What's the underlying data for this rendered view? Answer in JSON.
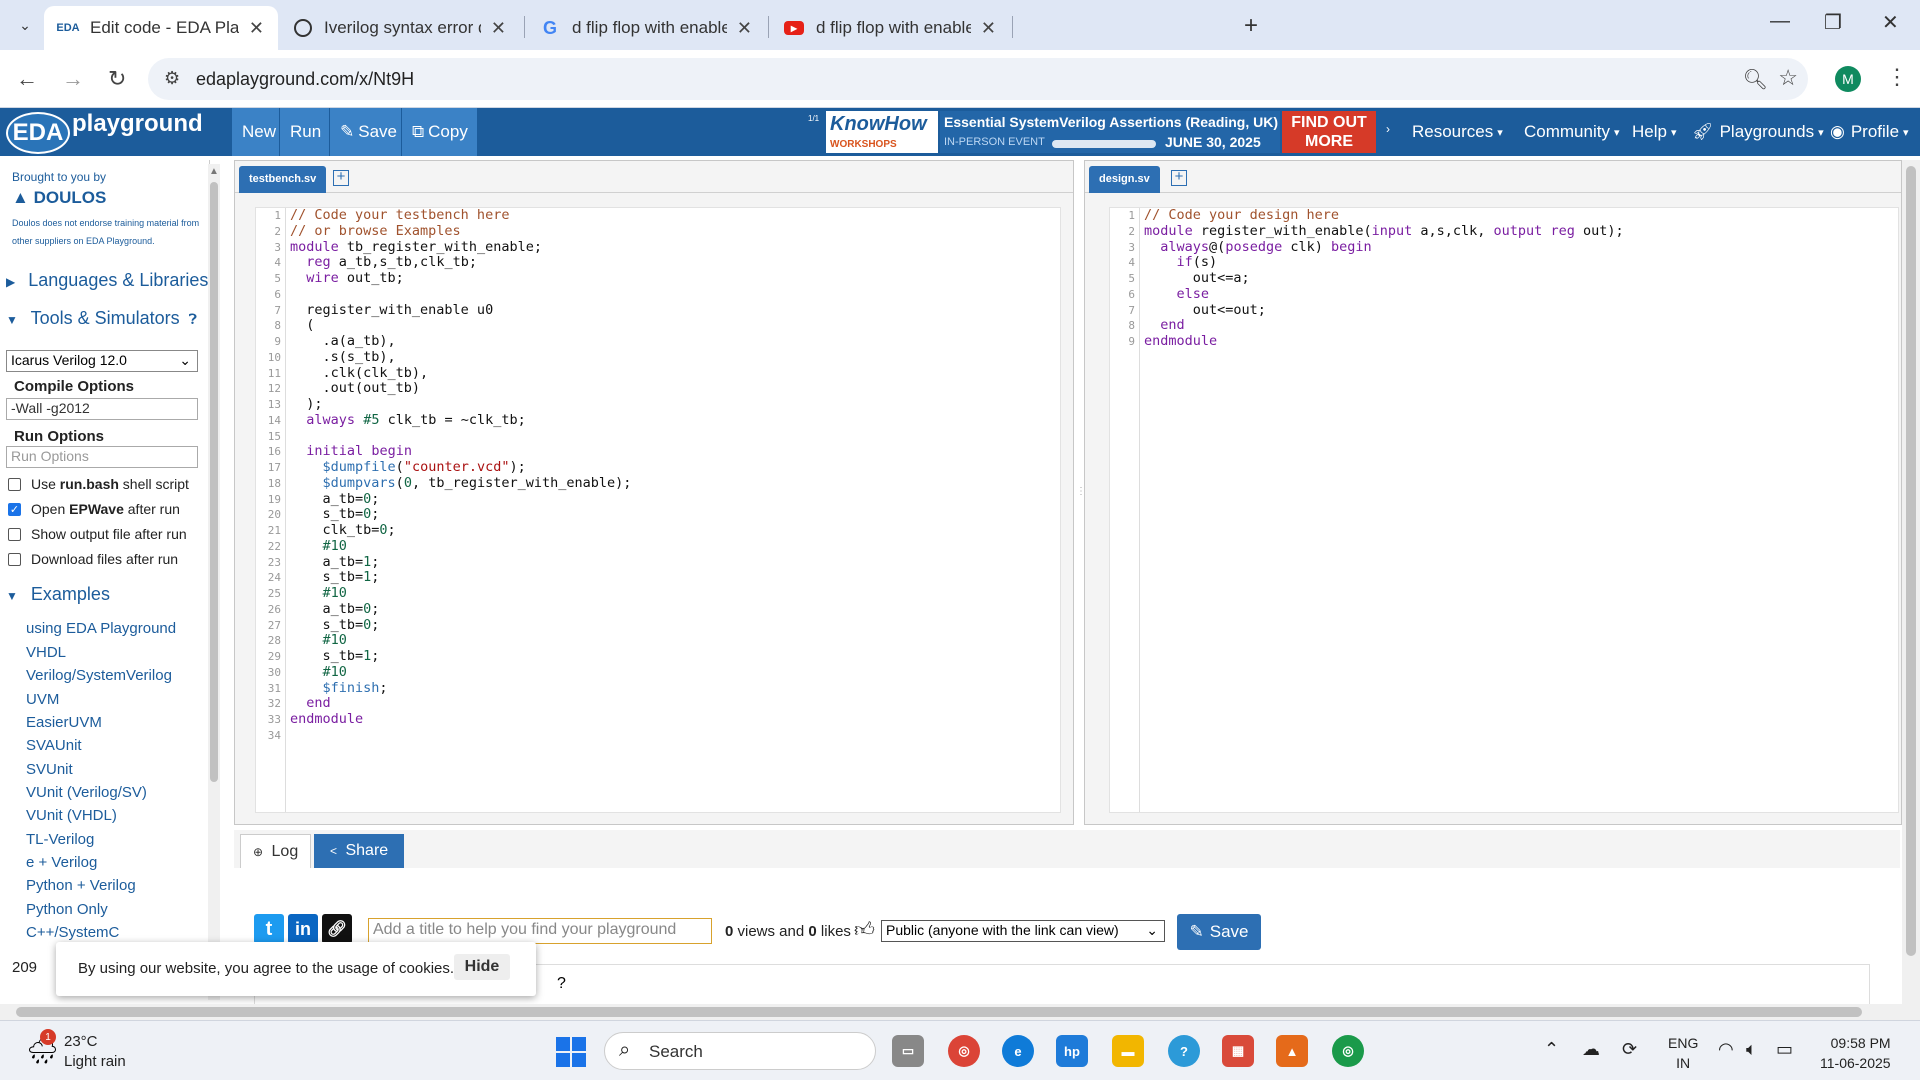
{
  "browser": {
    "tabs": [
      {
        "label": "Edit code - EDA Playground",
        "favicon": "eda-favicon",
        "active": true
      },
      {
        "label": "Iverilog syntax error debug",
        "favicon": "chatgpt-favicon",
        "active": false
      },
      {
        "label": "d flip flop with enable verilog c",
        "favicon": "google-favicon",
        "active": false
      },
      {
        "label": "d flip flop with enable - YouTub",
        "favicon": "youtube-favicon",
        "active": false
      }
    ],
    "url": "edaplayground.com/x/Nt9H",
    "profile_initial": "M"
  },
  "edanav": {
    "logo_eda": "EDA",
    "logo_playground": "playground",
    "buttons": {
      "new": "New",
      "run": "Run",
      "save": "Save",
      "copy": "Copy"
    },
    "ad": {
      "counter": "1/1",
      "know1": "KnowHow",
      "know2": "WORKSHOPS",
      "title": "Essential SystemVerilog Assertions (Reading, UK)",
      "event": "IN-PERSON EVENT",
      "date": "JUNE 30, 2025",
      "cta": "FIND OUT MORE"
    },
    "menu": {
      "resources": "Resources",
      "community": "Community",
      "help": "Help",
      "playgrounds": "Playgrounds",
      "profile": "Profile"
    }
  },
  "sidebar": {
    "brought": "Brought to you by",
    "doulos": "DOULOS",
    "disclaimer": "Doulos does not endorse training material from other suppliers on EDA Playground.",
    "languages": "Languages & Libraries",
    "tools": "Tools & Simulators",
    "simulator": "Icarus Verilog 12.0",
    "compile_label": "Compile Options",
    "compile_value": "-Wall -g2012",
    "run_label": "Run Options",
    "run_placeholder": "Run Options",
    "checks": [
      {
        "label_pre": "Use ",
        "label_bold": "run.bash",
        "label_post": " shell script",
        "checked": false
      },
      {
        "label_pre": "Open ",
        "label_bold": "EPWave",
        "label_post": " after run",
        "checked": true
      },
      {
        "label_pre": "Show output file after run",
        "label_bold": "",
        "label_post": "",
        "checked": false
      },
      {
        "label_pre": "Download files after run",
        "label_bold": "",
        "label_post": "",
        "checked": false
      }
    ],
    "examples": "Examples",
    "example_links": [
      "using EDA Playground",
      "VHDL",
      "Verilog/SystemVerilog",
      "UVM",
      "EasierUVM",
      "SVAUnit",
      "SVUnit",
      "VUnit (Verilog/SV)",
      "VUnit (VHDL)",
      "TL-Verilog",
      "e + Verilog",
      "Python + Verilog",
      "Python Only",
      "C++/SystemC"
    ],
    "count": "209"
  },
  "testbench": {
    "tab": "testbench.sv",
    "lines": [
      "// Code your testbench here",
      "// or browse Examples",
      "module tb_register_with_enable;",
      "  reg a_tb,s_tb,clk_tb;",
      "  wire out_tb;",
      "",
      "  register_with_enable u0",
      "  (",
      "    .a(a_tb),",
      "    .s(s_tb),",
      "    .clk(clk_tb),",
      "    .out(out_tb)",
      "  );",
      "  always #5 clk_tb = ~clk_tb;",
      "",
      "  initial begin",
      "    $dumpfile(\"counter.vcd\");",
      "    $dumpvars(0, tb_register_with_enable);",
      "    a_tb=0;",
      "    s_tb=0;",
      "    clk_tb=0;",
      "    #10",
      "    a_tb=1;",
      "    s_tb=1;",
      "    #10",
      "    a_tb=0;",
      "    s_tb=0;",
      "    #10",
      "    s_tb=1;",
      "    #10",
      "    $finish;",
      "  end",
      "endmodule",
      ""
    ]
  },
  "design": {
    "tab": "design.sv",
    "lines": [
      "// Code your design here",
      "module register_with_enable(input a,s,clk, output reg out);",
      "  always@(posedge clk) begin",
      "    if(s)",
      "      out<=a;",
      "    else",
      "      out<=out;",
      "  end",
      "endmodule"
    ]
  },
  "share": {
    "log_tab": "Log",
    "share_tab": "Share",
    "title_placeholder": "Add a title to help you find your playground",
    "views": "0",
    "views_label": " views and ",
    "likes": "0",
    "likes_label": " likes",
    "visibility": "Public (anyone with the link can view)",
    "save": "Save"
  },
  "cookie": {
    "text": "By using our website, you agree to the usage of cookies.",
    "hide": "Hide"
  },
  "taskbar": {
    "weather_badge": "1",
    "temp": "23°C",
    "condition": "Light rain",
    "search": "Search",
    "lang1": "ENG",
    "lang2": "IN",
    "time": "09:58 PM",
    "date": "11-06-2025"
  }
}
